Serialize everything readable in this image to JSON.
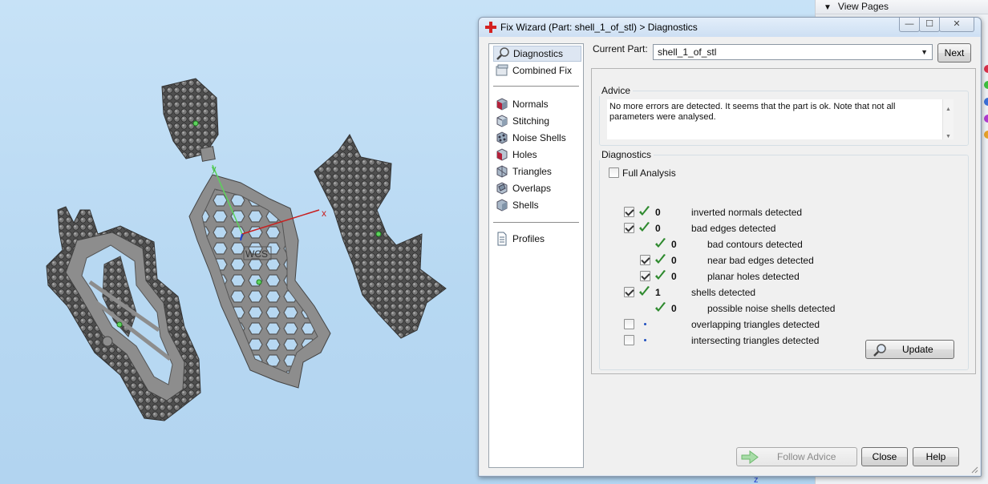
{
  "view_pages": {
    "title": "View Pages"
  },
  "dialog": {
    "title": "Fix Wizard (Part: shell_1_of_stl) > Diagnostics",
    "window_buttons": {
      "minimize": "—",
      "maximize": "☐",
      "close": "✕"
    }
  },
  "sidebar": {
    "group1": [
      {
        "label": "Diagnostics",
        "icon": "magnifier-icon",
        "selected": true
      },
      {
        "label": "Combined Fix",
        "icon": "combined-fix-icon"
      }
    ],
    "group2": [
      {
        "label": "Normals",
        "icon": "normals-cube-icon"
      },
      {
        "label": "Stitching",
        "icon": "stitching-cube-icon"
      },
      {
        "label": "Noise Shells",
        "icon": "noise-shells-icon"
      },
      {
        "label": "Holes",
        "icon": "holes-cube-icon"
      },
      {
        "label": "Triangles",
        "icon": "triangles-cube-icon"
      },
      {
        "label": "Overlaps",
        "icon": "overlaps-cube-icon"
      },
      {
        "label": "Shells",
        "icon": "shells-cube-icon"
      }
    ],
    "group3": [
      {
        "label": "Profiles",
        "icon": "document-icon"
      }
    ]
  },
  "current_part": {
    "label": "Current Part:",
    "value": "shell_1_of_stl",
    "next_label": "Next"
  },
  "advice": {
    "title": "Advice",
    "text": "No more errors are detected. It seems that the part is ok. Note that not all parameters were analysed."
  },
  "diagnostics": {
    "title": "Diagnostics",
    "full_analysis_label": "Full Analysis",
    "full_analysis_checked": false,
    "rows": [
      {
        "count": "0",
        "label": "inverted normals detected",
        "checked": true,
        "has_checkbox": true,
        "status": "ok",
        "indent": 0
      },
      {
        "count": "0",
        "label": "bad edges detected",
        "checked": true,
        "has_checkbox": true,
        "status": "ok",
        "indent": 0
      },
      {
        "count": "0",
        "label": "bad contours detected",
        "checked": false,
        "has_checkbox": false,
        "status": "ok",
        "indent": 1
      },
      {
        "count": "0",
        "label": "near bad edges detected",
        "checked": true,
        "has_checkbox": true,
        "status": "ok",
        "indent": 1
      },
      {
        "count": "0",
        "label": "planar holes detected",
        "checked": true,
        "has_checkbox": true,
        "status": "ok",
        "indent": 1
      },
      {
        "count": "1",
        "label": "shells detected",
        "checked": true,
        "has_checkbox": true,
        "status": "ok",
        "indent": 0
      },
      {
        "count": "0",
        "label": "possible noise shells detected",
        "checked": false,
        "has_checkbox": false,
        "status": "ok",
        "indent": 1
      },
      {
        "count": "",
        "label": "overlapping triangles detected",
        "checked": false,
        "has_checkbox": true,
        "status": "pending",
        "indent": 0
      },
      {
        "count": "",
        "label": "intersecting triangles detected",
        "checked": false,
        "has_checkbox": true,
        "status": "pending",
        "indent": 0
      }
    ],
    "update_label": "Update"
  },
  "footer": {
    "follow_advice_label": "Follow Advice",
    "close_label": "Close",
    "help_label": "Help"
  },
  "viewport": {
    "axis_x": "x",
    "axis_y": "y",
    "wcs_label": "WCS",
    "axis_z": "z"
  },
  "colors": {
    "check_green": "#2f8a2f",
    "accent_red": "#cc1f1f",
    "viewport_bg": "#b8d9f2"
  }
}
